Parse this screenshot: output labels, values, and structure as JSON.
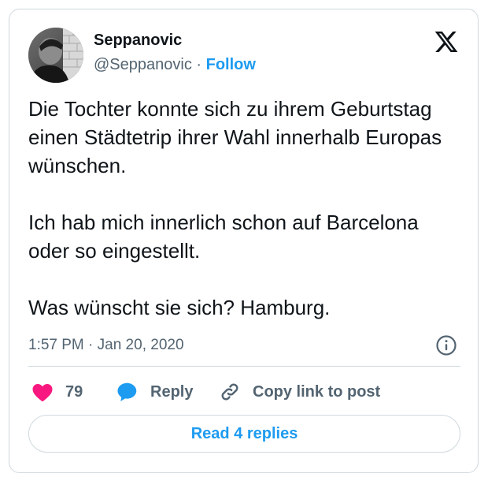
{
  "author": {
    "name": "Seppanovic",
    "handle": "@Seppanovic",
    "separator": "·",
    "follow_label": "Follow"
  },
  "brand": {
    "logo_icon": "x-logo-icon"
  },
  "tweet": {
    "paragraphs": [
      "Die Tochter konnte sich zu ihrem Geburtstag einen Städtetrip ihrer Wahl innerhalb Europas wünschen.",
      "Ich hab mich innerlich schon auf Barcelona oder so eingestellt.",
      "Was wünscht sie sich? Hamburg."
    ],
    "timestamp": "1:57 PM · Jan 20, 2020"
  },
  "actions": {
    "like_count": "79",
    "reply_label": "Reply",
    "copy_label": "Copy link to post"
  },
  "replies_button": {
    "label": "Read 4 replies"
  },
  "colors": {
    "accent": "#1d9bf0",
    "like": "#f91880",
    "text": "#0f1419",
    "muted": "#536471",
    "border": "#cfd9de"
  }
}
